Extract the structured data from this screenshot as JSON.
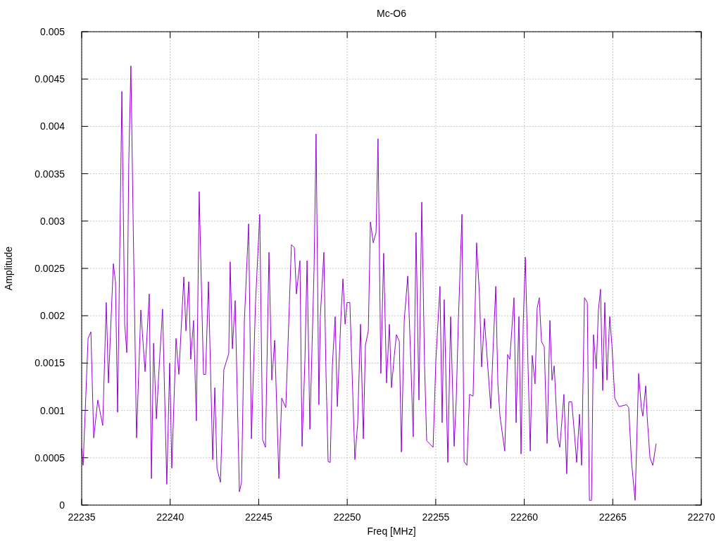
{
  "chart": {
    "chart_data": {
      "type": "line",
      "title": "Mc-O6",
      "xlabel": "Freq [MHz]",
      "ylabel": "Amplitude",
      "xlim": [
        22235,
        22270
      ],
      "ylim": [
        0,
        0.005
      ],
      "xticks": [
        22235,
        22240,
        22245,
        22250,
        22255,
        22260,
        22265,
        22270
      ],
      "yticks": [
        0,
        0.0005,
        0.001,
        0.0015,
        0.002,
        0.0025,
        0.003,
        0.0035,
        0.004,
        0.0045,
        0.005
      ],
      "grid": true,
      "x": [
        22235.0,
        22235.08,
        22235.36,
        22235.52,
        22235.68,
        22235.91,
        22236.19,
        22236.39,
        22236.51,
        22236.79,
        22236.91,
        22237.03,
        22237.27,
        22237.43,
        22237.55,
        22237.66,
        22237.78,
        22237.9,
        22238.1,
        22238.34,
        22238.58,
        22238.82,
        22238.94,
        22239.06,
        22239.22,
        22239.37,
        22239.57,
        22239.81,
        22239.97,
        22240.09,
        22240.33,
        22240.49,
        22240.77,
        22240.89,
        22241.05,
        22241.16,
        22241.32,
        22241.48,
        22241.64,
        22241.88,
        22242.0,
        22242.16,
        22242.4,
        22242.52,
        22242.64,
        22242.84,
        22243.03,
        22243.31,
        22243.39,
        22243.51,
        22243.67,
        22243.91,
        22244.03,
        22244.19,
        22244.43,
        22244.59,
        22244.82,
        22245.06,
        22245.22,
        22245.38,
        22245.58,
        22245.74,
        22245.9,
        22246.14,
        22246.3,
        22246.53,
        22246.85,
        22247.01,
        22247.13,
        22247.33,
        22247.45,
        22247.61,
        22247.73,
        22247.89,
        22248.13,
        22248.24,
        22248.4,
        22248.48,
        22248.68,
        22248.8,
        22248.92,
        22249.04,
        22249.16,
        22249.32,
        22249.44,
        22249.64,
        22249.76,
        22249.88,
        22249.99,
        22250.15,
        22250.43,
        22250.59,
        22250.75,
        22250.91,
        22251.03,
        22251.19,
        22251.31,
        22251.47,
        22251.63,
        22251.74,
        22251.9,
        22252.06,
        22252.22,
        22252.38,
        22252.5,
        22252.66,
        22252.78,
        22252.94,
        22253.06,
        22253.22,
        22253.42,
        22253.57,
        22253.73,
        22253.89,
        22254.05,
        22254.21,
        22254.37,
        22254.49,
        22254.85,
        22255.01,
        22255.24,
        22255.36,
        22255.48,
        22255.68,
        22255.84,
        22256.04,
        22256.16,
        22256.28,
        22256.48,
        22256.6,
        22256.76,
        22256.91,
        22257.11,
        22257.31,
        22257.47,
        22257.59,
        22257.75,
        22257.91,
        22258.11,
        22258.23,
        22258.39,
        22258.51,
        22258.63,
        22258.9,
        22259.06,
        22259.18,
        22259.42,
        22259.54,
        22259.7,
        22259.82,
        22259.94,
        22260.06,
        22260.18,
        22260.34,
        22260.45,
        22260.61,
        22260.73,
        22260.85,
        22260.97,
        22261.13,
        22261.29,
        22261.45,
        22261.57,
        22261.69,
        22261.89,
        22262.01,
        22262.24,
        22262.4,
        22262.52,
        22262.68,
        22262.84,
        22262.96,
        22263.12,
        22263.24,
        22263.4,
        22263.56,
        22263.68,
        22263.8,
        22263.91,
        22264.07,
        22264.19,
        22264.31,
        22264.43,
        22264.55,
        22264.67,
        22264.83,
        22264.95,
        22265.11,
        22265.35,
        22265.78,
        22265.9,
        22266.06,
        22266.26,
        22266.46,
        22266.62,
        22266.7,
        22266.86,
        22266.94,
        22267.1,
        22267.26,
        22267.45
      ],
      "series": [
        {
          "color": "#9400d3",
          "values": [
            0.0006,
            0.00042,
            0.00176,
            0.00183,
            0.00071,
            0.00111,
            0.00084,
            0.00214,
            0.00129,
            0.00255,
            0.00236,
            0.00098,
            0.00437,
            0.00191,
            0.00161,
            0.00362,
            0.00464,
            0.0031,
            0.00071,
            0.00206,
            0.00141,
            0.00223,
            0.00028,
            0.00171,
            0.00091,
            0.00144,
            0.00207,
            0.00022,
            0.0015,
            0.00039,
            0.00176,
            0.00138,
            0.00241,
            0.00184,
            0.00236,
            0.00154,
            0.00195,
            0.00089,
            0.00331,
            0.00138,
            0.00138,
            0.00236,
            0.00048,
            0.00124,
            0.00039,
            0.00024,
            0.00143,
            0.0016,
            0.00257,
            0.00165,
            0.00216,
            0.00014,
            0.00024,
            0.00195,
            0.00297,
            0.0007,
            0.00214,
            0.00307,
            0.00069,
            0.00061,
            0.00267,
            0.00132,
            0.00174,
            0.00028,
            0.00113,
            0.00103,
            0.00275,
            0.00272,
            0.00223,
            0.00258,
            0.00062,
            0.00154,
            0.00258,
            0.0008,
            0.00251,
            0.00392,
            0.00106,
            0.00199,
            0.00267,
            0.00139,
            0.00046,
            0.00045,
            0.00147,
            0.00199,
            0.00104,
            0.00197,
            0.00239,
            0.00191,
            0.00214,
            0.00214,
            0.00048,
            0.00087,
            0.00191,
            0.0007,
            0.00169,
            0.00184,
            0.00299,
            0.00277,
            0.00288,
            0.00387,
            0.00139,
            0.00266,
            0.00129,
            0.00191,
            0.00124,
            0.00158,
            0.0018,
            0.00173,
            0.00056,
            0.00195,
            0.00242,
            0.00164,
            0.00072,
            0.00288,
            0.00111,
            0.0032,
            0.00147,
            0.00068,
            0.00061,
            0.00154,
            0.00231,
            0.00087,
            0.00217,
            0.00045,
            0.00199,
            0.00062,
            0.00112,
            0.00195,
            0.00307,
            0.00046,
            0.00042,
            0.00117,
            0.00115,
            0.00277,
            0.00221,
            0.00146,
            0.00197,
            0.00154,
            0.00102,
            0.00161,
            0.00231,
            0.00128,
            0.00094,
            0.00057,
            0.00159,
            0.00154,
            0.00219,
            0.00087,
            0.00199,
            0.00054,
            0.00191,
            0.00262,
            0.00171,
            0.00057,
            0.00158,
            0.00128,
            0.00208,
            0.00219,
            0.00173,
            0.00167,
            0.00065,
            0.00195,
            0.00132,
            0.00147,
            0.00071,
            0.00061,
            0.00117,
            0.00033,
            0.00109,
            0.00109,
            0.00074,
            0.00045,
            0.00096,
            0.00042,
            0.00219,
            0.00214,
            5e-05,
            5e-05,
            0.0018,
            0.00144,
            0.00206,
            0.00228,
            0.00121,
            0.00214,
            0.00132,
            0.00199,
            0.0017,
            0.00113,
            0.00104,
            0.00106,
            0.00103,
            0.00046,
            5e-05,
            0.00139,
            0.00102,
            0.00094,
            0.00126,
            0.00094,
            0.0005,
            0.00042,
            0.00065
          ]
        }
      ]
    }
  }
}
